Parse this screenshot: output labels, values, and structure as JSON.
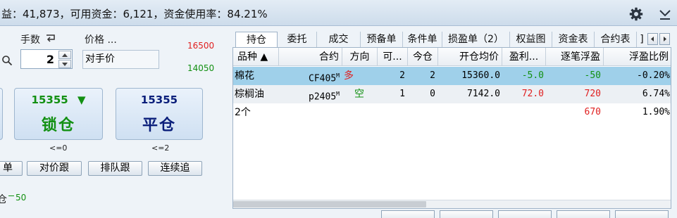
{
  "status_bar": {
    "summary": "益：41,873，可用资金：6,121，资金使用率：84.21%",
    "gear_icon": "gear-icon",
    "collapse_icon": "chevron-down-icon"
  },
  "order_panel": {
    "qty_label": "手数",
    "price_label": "价格 ...",
    "price_upper": "16500",
    "price_lower": "14050",
    "quantity": "2",
    "price_type": "对手价",
    "lock_button": {
      "price": "15355",
      "label": "锁仓",
      "arrow": "▼",
      "note": "<=0"
    },
    "close_button": {
      "price": "15355",
      "label": "平仓",
      "note": "<=2"
    },
    "small_buttons": [
      "单",
      "对价跟",
      "排队跟",
      "连续追"
    ],
    "position_label": "仓",
    "position_value": "50",
    "colors": {
      "green": "#129012",
      "navy": "#0a1e7a",
      "red": "#e02020"
    }
  },
  "tabs": [
    "持仓",
    "委托",
    "成交",
    "预备单",
    "条件单",
    "损盈单（2）",
    "权益图",
    "资金表",
    "合约表",
    "]"
  ],
  "positions": {
    "headers": [
      "品种 ▲",
      "合约",
      "方向",
      "可...",
      "今仓",
      "开仓均价",
      "盈利...",
      "逐笔浮盈",
      "浮盈比例"
    ],
    "rows": [
      {
        "name": "棉花",
        "contract": "CF405",
        "suffix": "M",
        "dir": "多",
        "avail": "2",
        "today": "2",
        "open_price": "15360.0",
        "profit": "-5.0",
        "float_pnl": "-50",
        "ratio": "-0.20%"
      },
      {
        "name": "棕榈油",
        "contract": "p2405",
        "suffix": "M",
        "dir": "空",
        "avail": "1",
        "today": "0",
        "open_price": "7142.0",
        "profit": "72.0",
        "float_pnl": "720",
        "ratio": "6.74%"
      }
    ],
    "total": {
      "count": "2个",
      "float_pnl": "670",
      "ratio": "1.90%"
    }
  }
}
